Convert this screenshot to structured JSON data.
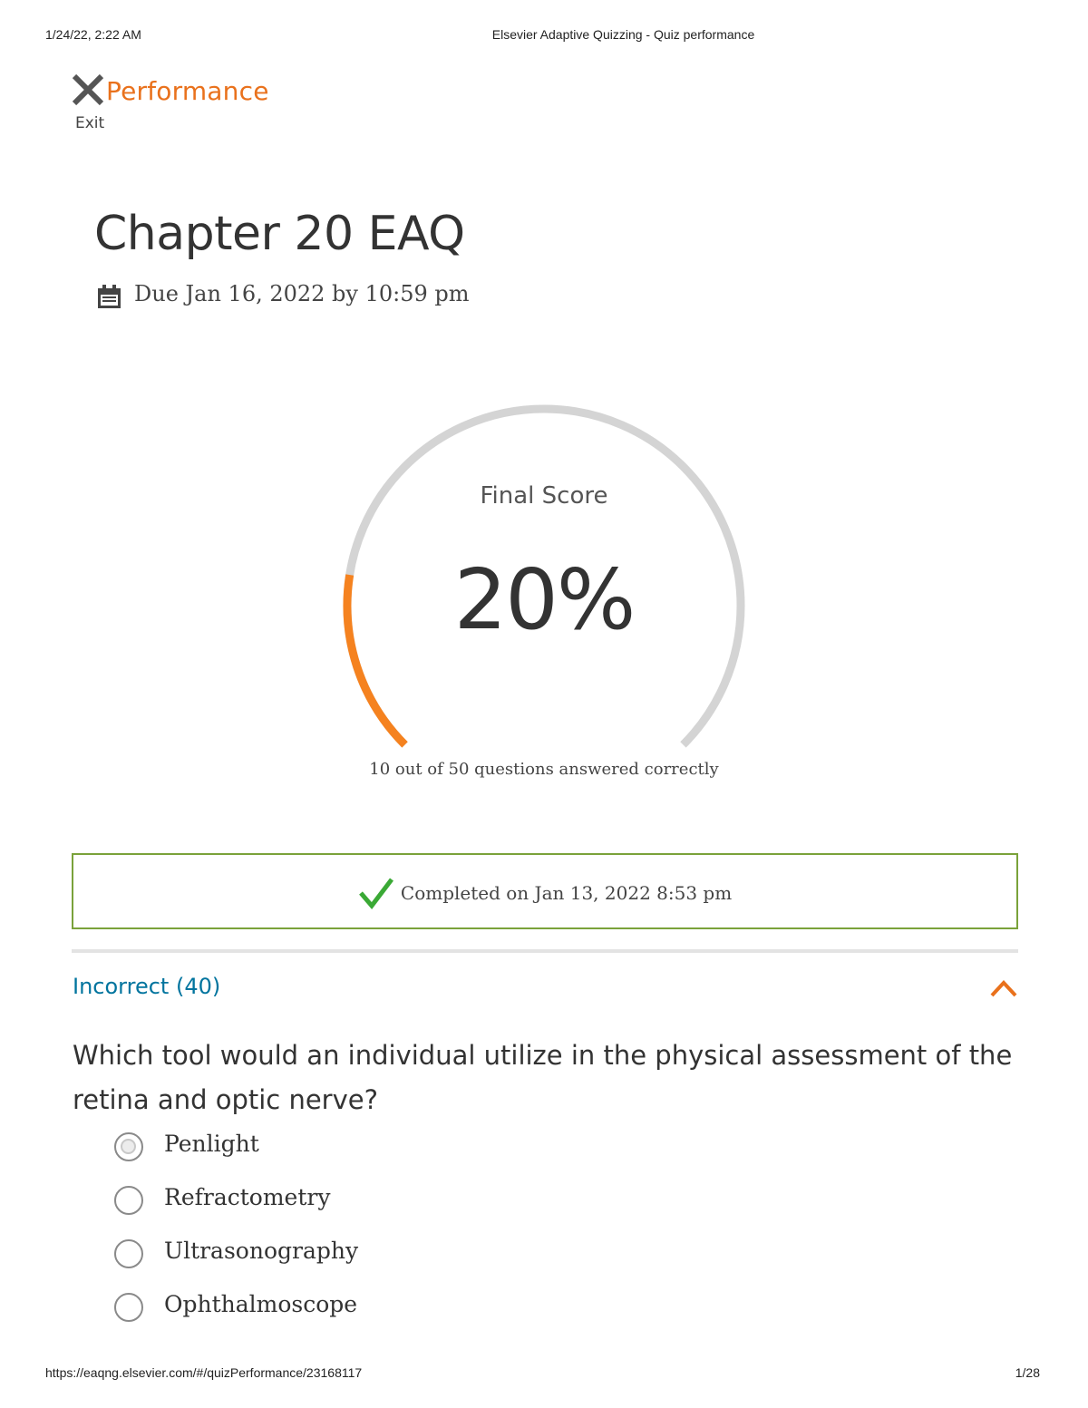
{
  "print": {
    "datetime": "1/24/22, 2:22 AM",
    "page_title": "Elsevier Adaptive Quizzing - Quiz performance",
    "url": "https://eaqng.elsevier.com/#/quizPerformance/23168117",
    "page_number": "1/28"
  },
  "header": {
    "title": "Performance",
    "exit_label": "Exit",
    "accent_color": "#e9711c"
  },
  "quiz": {
    "title": "Chapter 20 EAQ",
    "due": "Due Jan 16, 2022 by 10:59 pm"
  },
  "score": {
    "label": "Final Score",
    "percent_text": "20%",
    "percent_value": 20,
    "summary": "10 out of 50 questions answered correctly",
    "fill_color": "#f5821f",
    "track_color": "#d4d4d4"
  },
  "completion": {
    "text": "Completed on Jan 13, 2022 8:53 pm",
    "check_color": "#3aa935",
    "border_color": "#7aa23a"
  },
  "section": {
    "title": "Incorrect (40)",
    "title_color": "#00749e"
  },
  "question": {
    "text": "Which tool would an individual utilize in the physical assessment of the retina and optic nerve?",
    "options": [
      {
        "label": "Penlight",
        "selected": true
      },
      {
        "label": "Refractometry",
        "selected": false
      },
      {
        "label": "Ultrasonography",
        "selected": false
      },
      {
        "label": "Ophthalmoscope",
        "selected": false
      }
    ]
  }
}
